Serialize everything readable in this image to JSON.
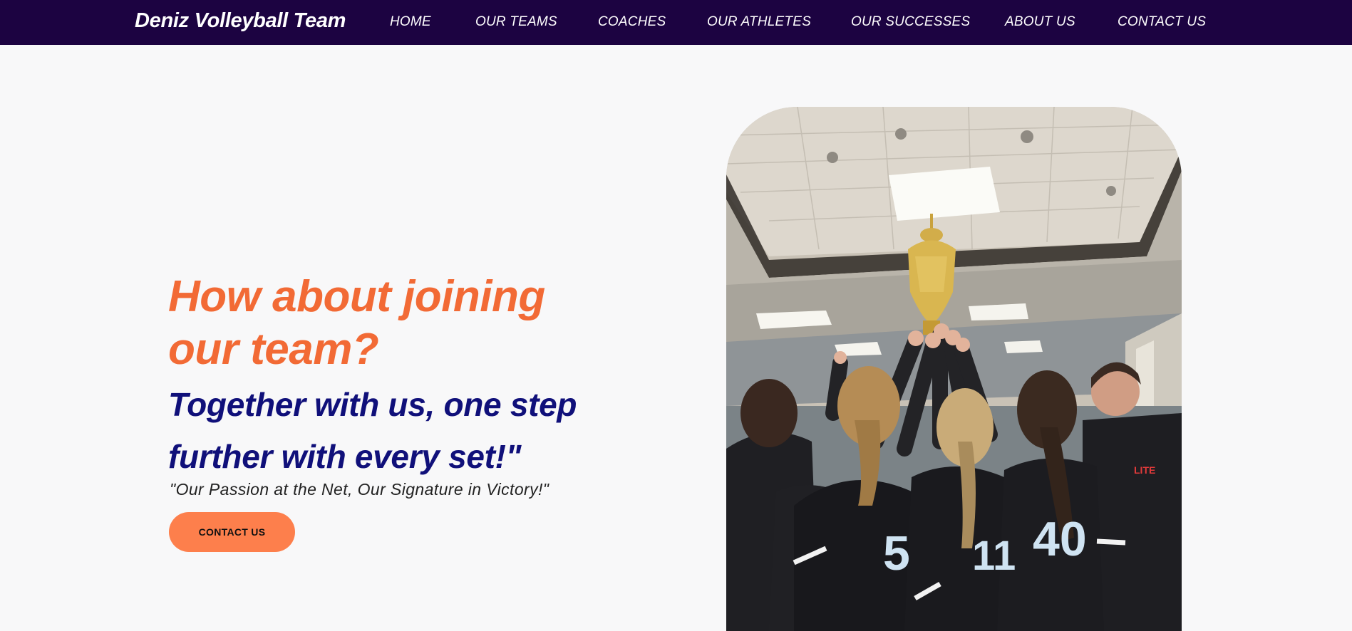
{
  "header": {
    "brand": "Deniz Volleyball Team",
    "nav": [
      {
        "label": "HOME"
      },
      {
        "label": "OUR TEAMS"
      },
      {
        "label": "COACHES"
      },
      {
        "label": "OUR ATHLETES"
      },
      {
        "label": "OUR SUCCESSES"
      },
      {
        "label": "ABOUT US"
      },
      {
        "label": "CONTACT US"
      }
    ]
  },
  "hero": {
    "title": "How about joining our team?",
    "subtitle": "Together with us, one step further with every set!\"",
    "quote": "\"Our Passion at the Net, Our Signature in Victory!\"",
    "cta_label": "CONTACT US",
    "photo": {
      "jersey_numbers": [
        "5",
        "11",
        "40"
      ],
      "shirt_text": "LITE",
      "colors": {
        "orange": "#f26a35",
        "navy": "#10107a",
        "nav_bg": "#1c0341"
      }
    }
  }
}
